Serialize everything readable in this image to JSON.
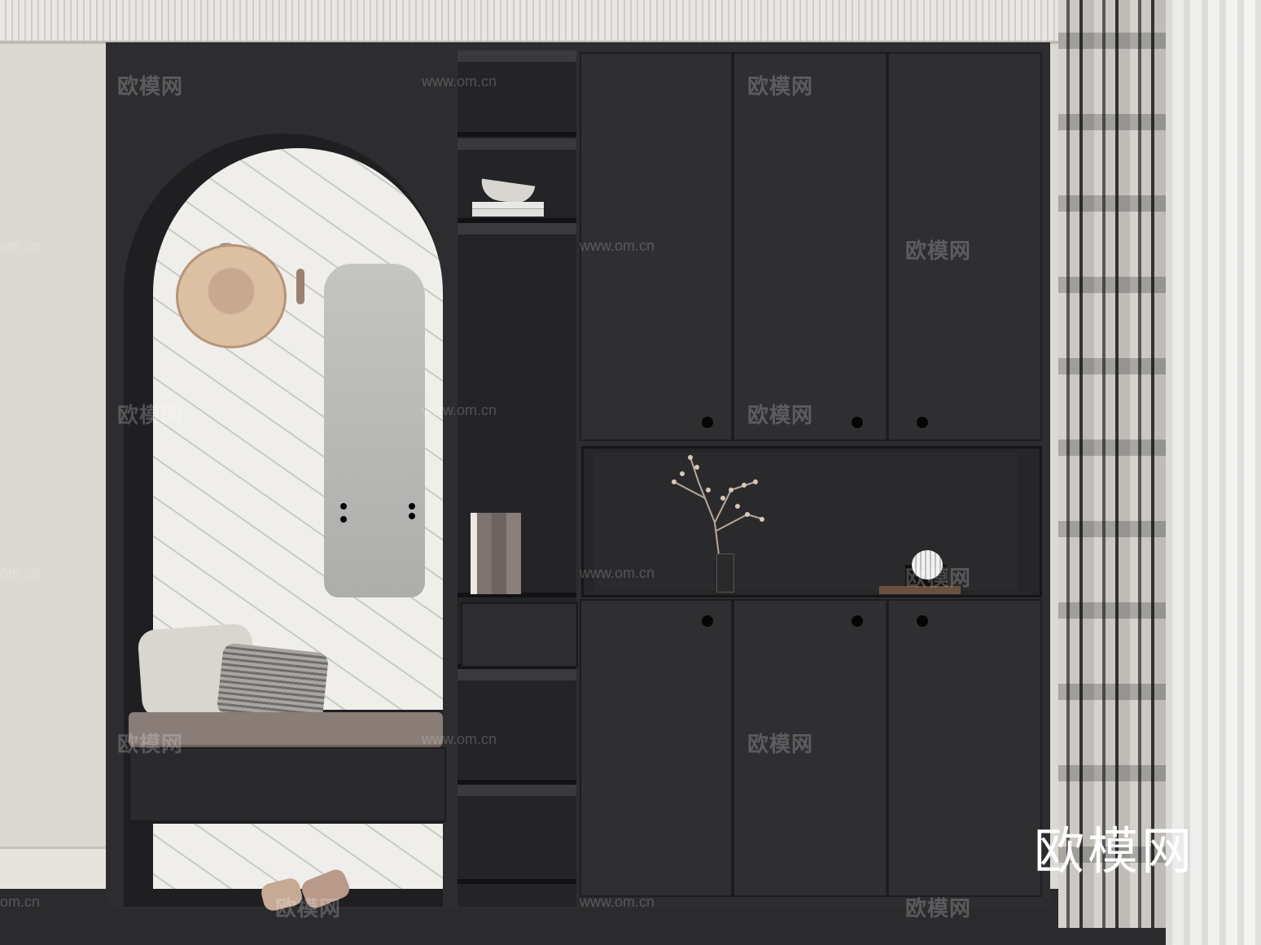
{
  "scene": {
    "logo_text": "欧模网"
  },
  "watermarks": {
    "brand": "欧模网",
    "url": "www.om.cn",
    "url_short": "om.cn"
  },
  "colors": {
    "cabinet": "#2d2d30",
    "wall": "#dcd8d2",
    "cushion": "#8a7c76",
    "knob": "#050505"
  }
}
